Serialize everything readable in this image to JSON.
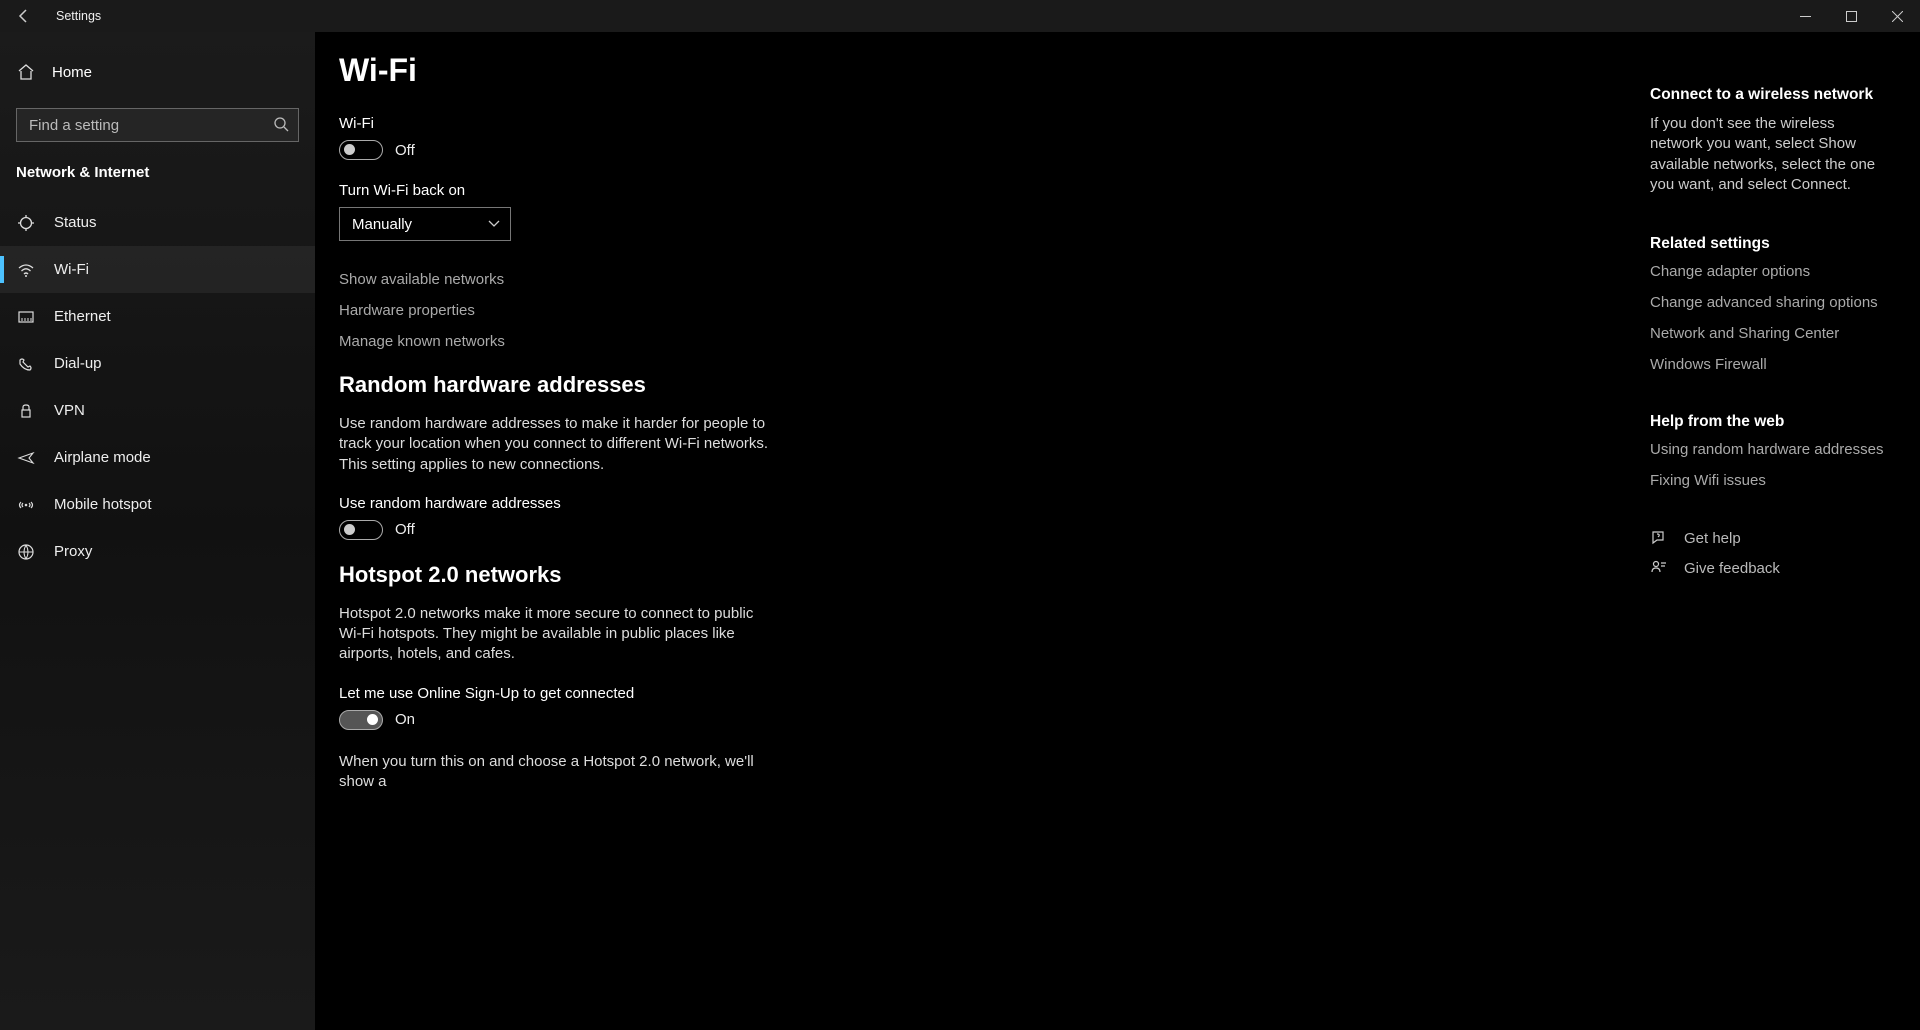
{
  "titlebar": {
    "title": "Settings"
  },
  "sidebar": {
    "home": "Home",
    "search_placeholder": "Find a setting",
    "section": "Network & Internet",
    "items": [
      {
        "label": "Status",
        "icon": "status-icon"
      },
      {
        "label": "Wi-Fi",
        "icon": "wifi-icon"
      },
      {
        "label": "Ethernet",
        "icon": "ethernet-icon"
      },
      {
        "label": "Dial-up",
        "icon": "dialup-icon"
      },
      {
        "label": "VPN",
        "icon": "vpn-icon"
      },
      {
        "label": "Airplane mode",
        "icon": "airplane-icon"
      },
      {
        "label": "Mobile hotspot",
        "icon": "hotspot-icon"
      },
      {
        "label": "Proxy",
        "icon": "proxy-icon"
      }
    ],
    "selected_index": 1
  },
  "main": {
    "title": "Wi-Fi",
    "wifi_label": "Wi-Fi",
    "wifi_state_text": "Off",
    "turn_back_on_label": "Turn Wi-Fi back on",
    "turn_back_on_value": "Manually",
    "links": {
      "show_networks": "Show available networks",
      "hardware_props": "Hardware properties",
      "manage_known": "Manage known networks"
    },
    "random_hw": {
      "heading": "Random hardware addresses",
      "desc": "Use random hardware addresses to make it harder for people to track your location when you connect to different Wi-Fi networks. This setting applies to new connections.",
      "toggle_label": "Use random hardware addresses",
      "toggle_state_text": "Off"
    },
    "hotspot": {
      "heading": "Hotspot 2.0 networks",
      "desc": "Hotspot 2.0 networks make it more secure to connect to public Wi-Fi hotspots. They might be available in public places like airports, hotels, and cafes.",
      "toggle_label": "Let me use Online Sign-Up to get connected",
      "toggle_state_text": "On",
      "more": "When you turn this on and choose a Hotspot 2.0 network, we'll show a"
    }
  },
  "right": {
    "connect_title": "Connect to a wireless network",
    "connect_text": "If you don't see the wireless network you want, select Show available networks, select the one you want, and select Connect.",
    "related_title": "Related settings",
    "related_links": {
      "adapter": "Change adapter options",
      "sharing": "Change advanced sharing options",
      "center": "Network and Sharing Center",
      "firewall": "Windows Firewall"
    },
    "help_title": "Help from the web",
    "help_links": {
      "random": "Using random hardware addresses",
      "fixing": "Fixing Wifi issues"
    },
    "get_help": "Get help",
    "give_feedback": "Give feedback"
  }
}
